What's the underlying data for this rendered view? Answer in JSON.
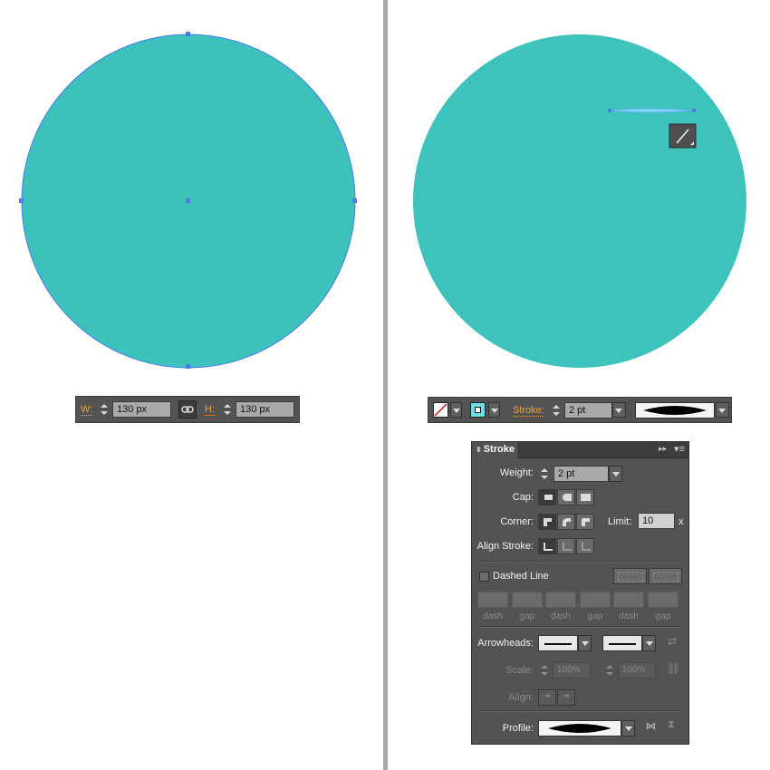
{
  "left": {
    "shape_color": "#3cc1bb",
    "anchor_color": "#4a7cf0",
    "width_label": "W:",
    "width_value": "130 px",
    "height_label": "H:",
    "height_value": "130 px",
    "constrain_icon": "link-icon"
  },
  "right": {
    "shape_color": "#3dc2bc",
    "control_bar": {
      "fill_icon": "none-fill-swatch-icon",
      "stroke_icon": "stroke-swatch-icon",
      "stroke_label": "Stroke:",
      "stroke_value": "2 pt",
      "profile_icon": "width-profile-icon"
    },
    "tool_tooltip_icon": "line-segment-icon"
  },
  "panel": {
    "title": "Stroke",
    "weight_label": "Weight:",
    "weight_value": "2 pt",
    "cap_label": "Cap:",
    "corner_label": "Corner:",
    "limit_label": "Limit:",
    "limit_value": "10",
    "limit_unit": "x",
    "align_label": "Align Stroke:",
    "dashed_label": "Dashed Line",
    "dash_labels": [
      "dash",
      "gap",
      "dash",
      "gap",
      "dash",
      "gap"
    ],
    "arrowheads_label": "Arrowheads:",
    "scale_label": "Scale:",
    "scale_value_1": "100%",
    "scale_value_2": "100%",
    "align_arrow_label": "Align:",
    "profile_label": "Profile:"
  }
}
